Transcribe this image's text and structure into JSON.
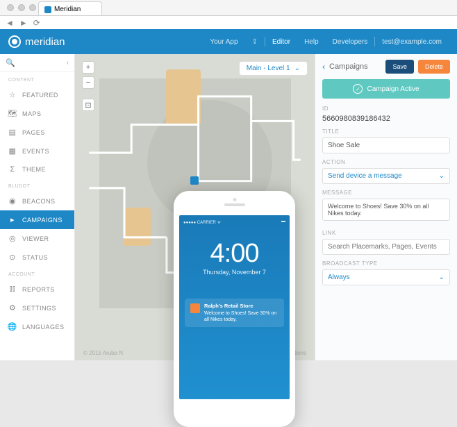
{
  "browser": {
    "tab_title": "Meridian"
  },
  "header": {
    "brand": "meridian",
    "nav": {
      "your_app": "Your App",
      "editor": "Editor",
      "help": "Help",
      "developers": "Developers",
      "user": "test@example.com"
    }
  },
  "sidebar": {
    "sections": {
      "content": "CONTENT",
      "bludot": "BLUDOT",
      "account": "ACCOUNT"
    },
    "items": {
      "featured": "FEATURED",
      "maps": "MAPS",
      "pages": "PAGES",
      "events": "EVENTS",
      "theme": "THEME",
      "beacons": "BEACONS",
      "campaigns": "CAMPAIGNS",
      "viewer": "VIEWER",
      "status": "STATUS",
      "reports": "REPORTS",
      "settings": "SETTINGS",
      "languages": "LANGUAGES"
    }
  },
  "map": {
    "level_selector": "Main - Level 1",
    "footer": "© 2015 Aruba N",
    "terms": "rms & Conditions"
  },
  "panel": {
    "title": "Campaigns",
    "save": "Save",
    "delete": "Delete",
    "status": "Campaign Active",
    "fields": {
      "id_label": "ID",
      "id_value": "5660980839186432",
      "title_label": "TITLE",
      "title_value": "Shoe Sale",
      "action_label": "ACTION",
      "action_value": "Send device a message",
      "message_label": "MESSAGE",
      "message_value": "Welcome to Shoes! Save 30% on all Nikes today.",
      "link_label": "LINK",
      "link_placeholder": "Search Placemarks, Pages, Events",
      "broadcast_label": "BROADCAST TYPE",
      "broadcast_value": "Always"
    }
  },
  "phone": {
    "carrier": "CARRIER",
    "time": "4:00",
    "date": "Thursday, November 7",
    "notif_title": "Ralph's Retail Store",
    "notif_body": "Welcome to Shoes! Save 30% on all Nikes today."
  }
}
